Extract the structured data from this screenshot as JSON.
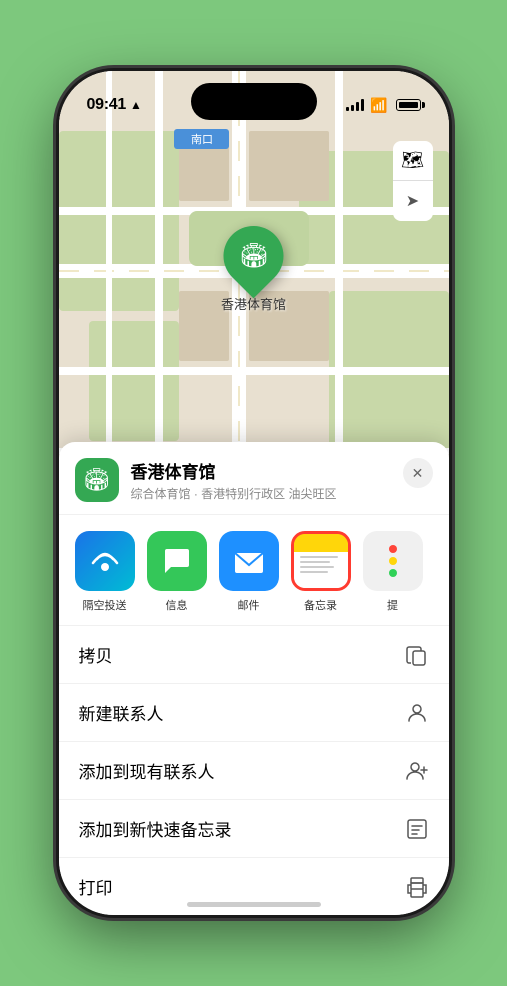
{
  "status_bar": {
    "time": "09:41",
    "location_arrow": "▲"
  },
  "map": {
    "label_nankou": "南口",
    "location_name": "香港体育馆",
    "controls": {
      "map_icon": "🗺",
      "location_icon": "➤"
    }
  },
  "place_card": {
    "name": "香港体育馆",
    "subtitle": "综合体育馆 · 香港特别行政区 油尖旺区",
    "close_label": "✕"
  },
  "share_items": [
    {
      "id": "airdrop",
      "label": "隔空投送",
      "type": "airdrop"
    },
    {
      "id": "messages",
      "label": "信息",
      "type": "messages"
    },
    {
      "id": "mail",
      "label": "邮件",
      "type": "mail"
    },
    {
      "id": "notes",
      "label": "备忘录",
      "type": "notes",
      "selected": true
    },
    {
      "id": "more",
      "label": "提",
      "type": "more"
    }
  ],
  "actions": [
    {
      "id": "copy",
      "label": "拷贝",
      "icon": "copy"
    },
    {
      "id": "new-contact",
      "label": "新建联系人",
      "icon": "person"
    },
    {
      "id": "add-contact",
      "label": "添加到现有联系人",
      "icon": "person-add"
    },
    {
      "id": "quick-note",
      "label": "添加到新快速备忘录",
      "icon": "note"
    },
    {
      "id": "print",
      "label": "打印",
      "icon": "printer"
    }
  ],
  "colors": {
    "green": "#34a853",
    "red": "#ff3b30",
    "blue": "#1e90ff"
  }
}
